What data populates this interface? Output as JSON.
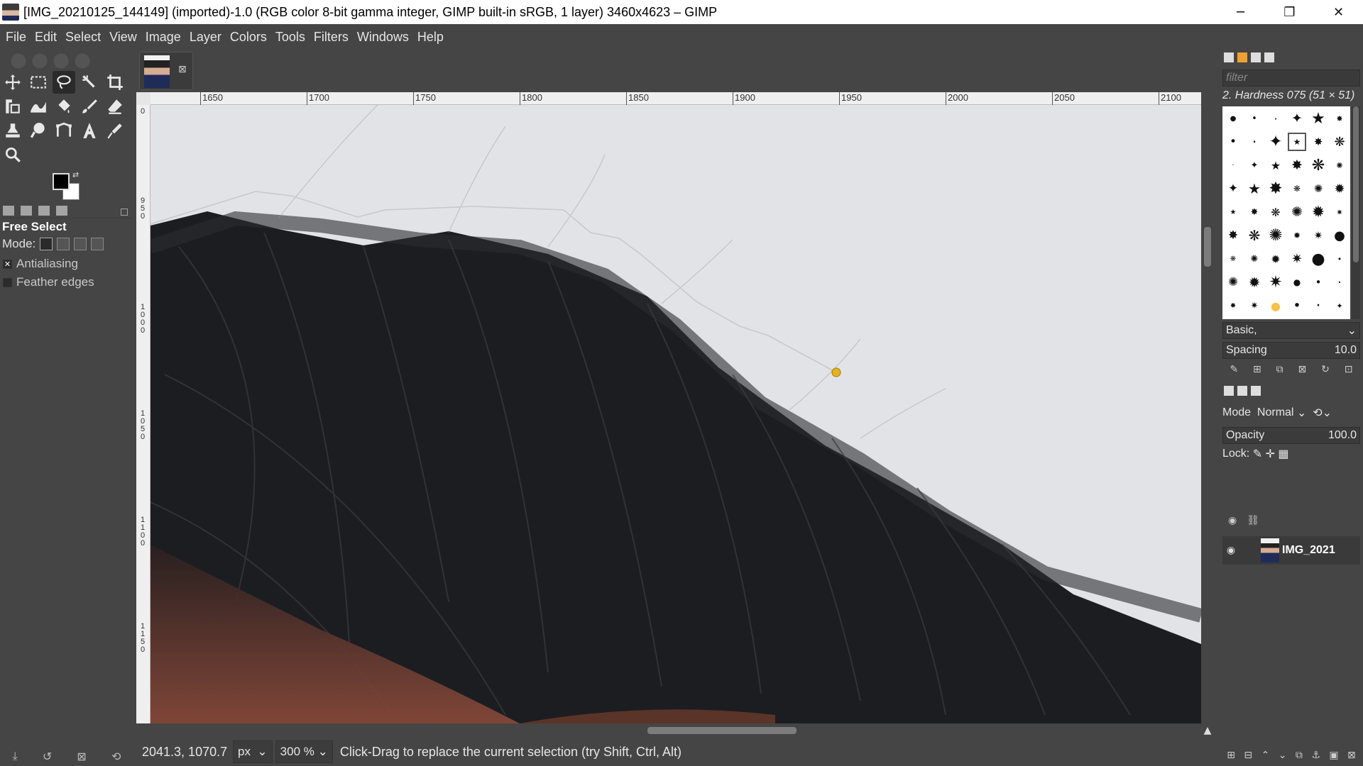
{
  "window": {
    "title": "[IMG_20210125_144149] (imported)-1.0 (RGB color 8-bit gamma integer, GIMP built-in sRGB, 1 layer) 3460x4623 – GIMP",
    "minimize_glyph": "─",
    "maximize_glyph": "❐",
    "close_glyph": "✕"
  },
  "menu": [
    "File",
    "Edit",
    "Select",
    "View",
    "Image",
    "Layer",
    "Colors",
    "Tools",
    "Filters",
    "Windows",
    "Help"
  ],
  "toolbox": {
    "tools": [
      "move-tool-icon",
      "rect-select-icon",
      "free-select-icon",
      "fuzzy-select-icon",
      "crop-icon",
      "unified-transform-icon",
      "warp-transform-icon",
      "bucket-fill-icon",
      "paintbrush-icon",
      "eraser-icon",
      "clone-icon",
      "smudge-icon",
      "paths-icon",
      "text-icon",
      "color-picker-icon",
      "zoom-icon"
    ],
    "active_tool": "free-select-icon",
    "fg_color": "#000000",
    "bg_color": "#ffffff"
  },
  "tool_options": {
    "name": "Free Select",
    "mode_label": "Mode:",
    "antialiasing": {
      "label": "Antialiasing",
      "checked": true
    },
    "feather": {
      "label": "Feather edges",
      "checked": false
    }
  },
  "ruler": {
    "h_labels": [
      "1650",
      "1700",
      "1750",
      "1800",
      "1850",
      "1900",
      "1950",
      "2000",
      "2050",
      "2100"
    ],
    "v_labels": [
      "0",
      "9 5 0",
      "1 0 0 0",
      "1 0 5 0",
      "1 1 0 0",
      "1 1 5 0"
    ]
  },
  "status": {
    "coords": "2041.3, 1070.7",
    "unit": "px",
    "zoom": "300 %",
    "message": "Click-Drag to replace the current selection (try Shift, Ctrl, Alt)"
  },
  "brushes": {
    "filter_placeholder": "filter",
    "selected": "2. Hardness 075 (51 × 51)",
    "preset": "Basic,",
    "spacing_label": "Spacing",
    "spacing_value": "10.0"
  },
  "layers": {
    "mode_label": "Mode",
    "mode_value": "Normal",
    "opacity_label": "Opacity",
    "opacity_value": "100.0",
    "lock_label": "Lock:",
    "layer_name": "IMG_2021"
  }
}
